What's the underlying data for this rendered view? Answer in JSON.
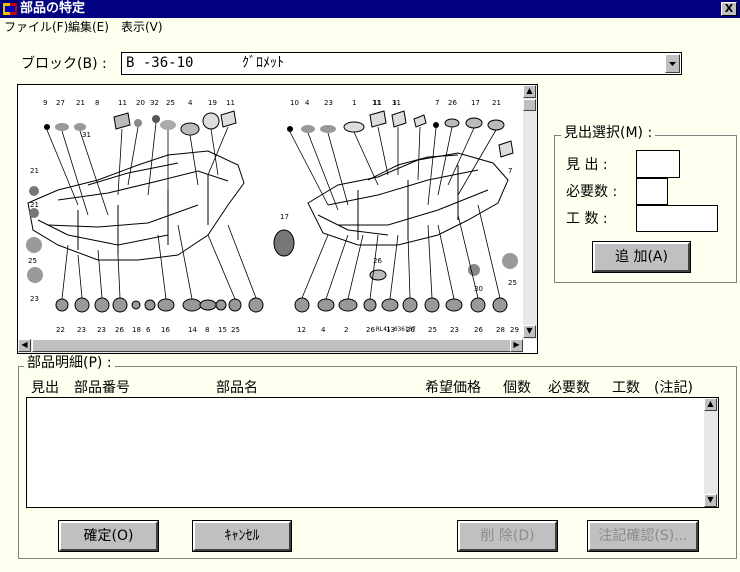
{
  "window": {
    "title": "部品の特定",
    "close_label": "X"
  },
  "menu": {
    "file": "ファイル(F)",
    "edit": "編集(E)",
    "view": "表示(V)"
  },
  "block": {
    "label": "ブロック(B) :",
    "code": "B  -36-10",
    "name": "ｸﾞﾛﾒｯﾄ"
  },
  "diagram": {
    "code": "RL41-036107",
    "top_labels_left": [
      "9",
      "27",
      "21",
      "8",
      "11",
      "20",
      "32",
      "25",
      "4",
      "19",
      "11"
    ],
    "top_labels_right": [
      "10",
      "4",
      "23",
      "1",
      "11",
      "3",
      "7",
      "26",
      "17",
      "21"
    ],
    "side_labels_left": [
      "31",
      "21",
      "21",
      "25",
      "23"
    ],
    "side_labels_right": [
      "11",
      "11",
      "7",
      "26",
      "25",
      "17",
      "30"
    ],
    "bottom_labels_left": [
      "22",
      "23",
      "23",
      "26",
      "18",
      "6",
      "16",
      "14",
      "8",
      "15",
      "25"
    ],
    "bottom_labels_right": [
      "12",
      "4",
      "2",
      "26",
      "13",
      "26",
      "25",
      "23",
      "26",
      "28",
      "29"
    ]
  },
  "midashi_select": {
    "label": "見出選択(M) :",
    "midashi": "見  出 :",
    "required": "必要数 :",
    "kosu": "工  数 :",
    "add_button": "追  加(A)"
  },
  "parts_detail": {
    "label": "部品明細(P) :",
    "columns": [
      "見出",
      "部品番号",
      "部品名",
      "希望価格",
      "個数",
      "必要数",
      "工数",
      "(注記)"
    ],
    "rows": []
  },
  "buttons": {
    "confirm": "確定(O)",
    "cancel": "ｷｬﾝｾﾙ",
    "delete": "削  除(D)",
    "note_confirm": "注記確認(S)..."
  },
  "colors": {
    "titlebar": "#000080",
    "background": "#fffff0",
    "button_face": "#c0c0c0",
    "disabled_text": "#8c8c8c"
  }
}
